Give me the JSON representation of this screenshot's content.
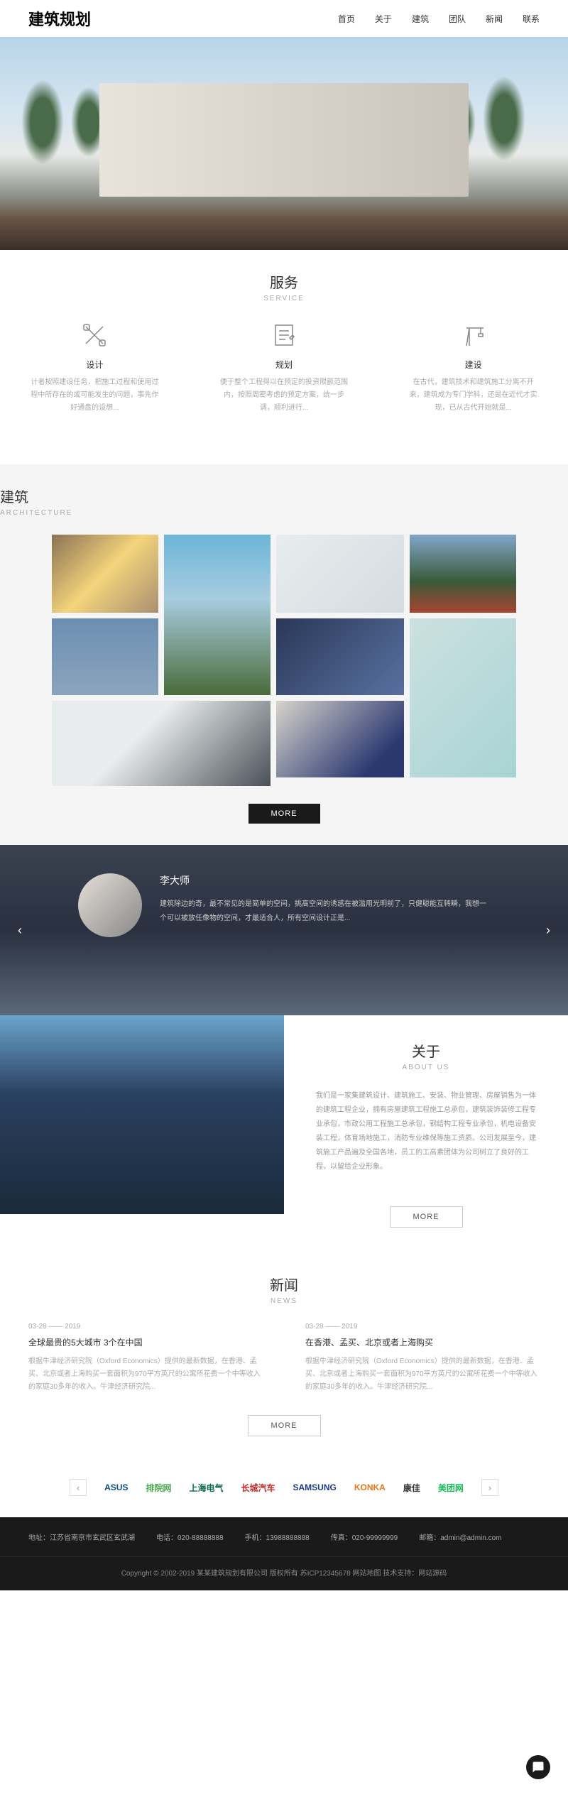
{
  "header": {
    "logo": "建筑规划",
    "nav": [
      "首页",
      "关于",
      "建筑",
      "团队",
      "新闻",
      "联系"
    ]
  },
  "services": {
    "title": "服务",
    "subtitle": "SERVICE",
    "items": [
      {
        "name": "设计",
        "desc": "计者按照建设任务，把施工过程和使用过程中所存在的或可能发生的问题，事先作好通盘的设想..."
      },
      {
        "name": "规划",
        "desc": "便于整个工程得以在预定的投资限额范围内，按照周密考虑的预定方案，统一步调，顺利进行..."
      },
      {
        "name": "建设",
        "desc": "在古代，建筑技术和建筑施工分离不开来，建筑成为专门学科，还是在近代才实现，已从古代开始就是..."
      }
    ]
  },
  "architecture": {
    "title": "建筑",
    "subtitle": "ARCHITECTURE",
    "more": "MORE"
  },
  "team": {
    "name": "李大师",
    "desc": "建筑除边的奇，最不常见的是简单的空间，挑高空间的诱惑在被滥用光明前了，只健聪能互转瞬，我想一个可以被放任像物的空间，才最适合人，所有空间设计正是..."
  },
  "about": {
    "title": "关于",
    "subtitle": "ABOUT US",
    "text": "我们是一家集建筑设计、建筑施工、安装、物业管理、房屋销售为一体的建筑工程企业，拥有房屋建筑工程施工总承包，建筑装饰装修工程专业承包，市政公用工程施工总承包，钢结构工程专业承包，机电设备安装工程，体育场地施工，消防专业维保等施工资质。公司发展至今，建筑施工产品遍及全国各地，员工的工高素团体为公司树立了良好的工程，以留给企业形象。",
    "more": "MORE"
  },
  "news": {
    "title": "新闻",
    "subtitle": "NEWS",
    "items": [
      {
        "date": "03-28 —— 2019",
        "title": "全球最贵的5大城市 3个在中国",
        "desc": "根据牛津经济研究院（Oxford Economics）提供的最新数据，在香港、孟买、北京或者上海购买一套面积为970平方英尺的公寓所花费一个中等收入的家庭30多年的收入。牛津经济研究院..."
      },
      {
        "date": "03-28 —— 2019",
        "title": "在香港、孟买、北京或者上海购买",
        "desc": "根据牛津经济研究院（Oxford Economics）提供的最新数据，在香港、孟买、北京或者上海购买一套面积为970平方英尺的公寓所花费一个中等收入的家庭30多年的收入。牛津经济研究院..."
      }
    ],
    "more": "MORE"
  },
  "partners": [
    "ASUS",
    "排院网",
    "上海电气",
    "长城汽车",
    "SAMSUNG",
    "KONKA",
    "康佳",
    "美团网"
  ],
  "footer": {
    "address": "地址：江苏省南京市玄武区玄武湖",
    "phone": "电话：020-88888888",
    "mobile": "手机：13988888888",
    "fax": "传真：020-99999999",
    "email": "邮箱：admin@admin.com",
    "copyright": "Copyright © 2002-2019 某某建筑规划有限公司 版权所有   苏ICP12345678   网站地图   技术支持：网站源码"
  }
}
